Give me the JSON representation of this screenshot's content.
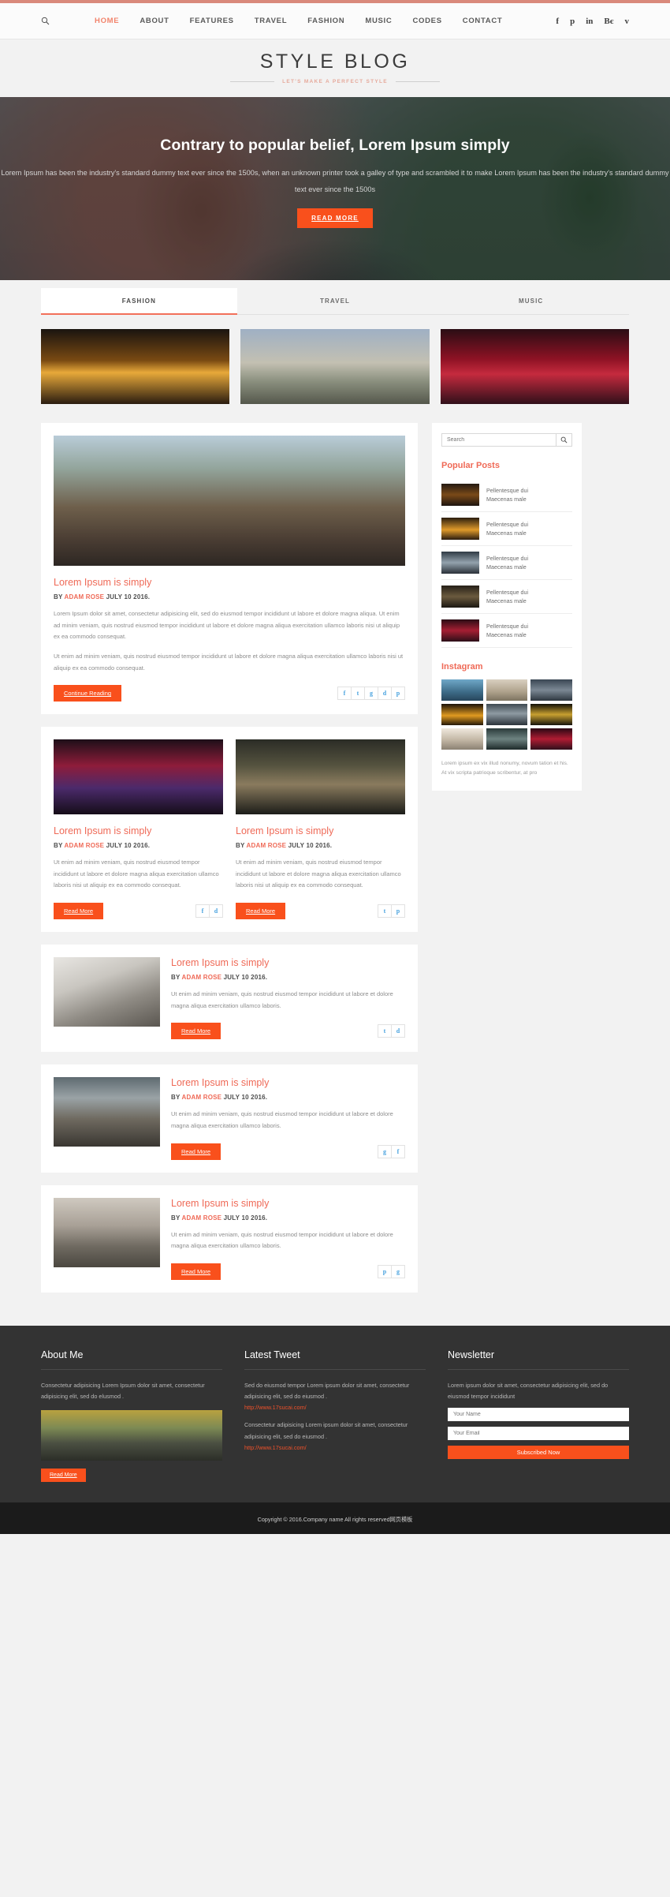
{
  "nav": {
    "search_icon": "search-icon",
    "links": [
      {
        "label": "HOME",
        "active": true
      },
      {
        "label": "ABOUT",
        "active": false
      },
      {
        "label": "FEATURES",
        "active": false
      },
      {
        "label": "TRAVEL",
        "active": false
      },
      {
        "label": "FASHION",
        "active": false
      },
      {
        "label": "MUSIC",
        "active": false
      },
      {
        "label": "CODES",
        "active": false
      },
      {
        "label": "CONTACT",
        "active": false
      }
    ],
    "social": [
      {
        "name": "facebook-icon",
        "glyph": "f"
      },
      {
        "name": "pinterest-icon",
        "glyph": "р"
      },
      {
        "name": "linkedin-icon",
        "glyph": "in"
      },
      {
        "name": "behance-icon",
        "glyph": "Bє"
      },
      {
        "name": "vimeo-icon",
        "glyph": "v"
      }
    ]
  },
  "logo": {
    "title": "STYLE BLOG",
    "tagline": "LET'S MAKE A PERFECT STYLE"
  },
  "hero": {
    "heading": "Contrary to popular belief, Lorem Ipsum simply",
    "paragraph": "Lorem Ipsum has been the industry's standard dummy text ever since the 1500s, when an unknown printer took a galley of type and scrambled it to make Lorem Ipsum has been the industry's standard dummy text ever since the 1500s",
    "button": "READ MORE",
    "accent": "#f9501c"
  },
  "tabs": [
    {
      "label": "FASHION",
      "active": true
    },
    {
      "label": "TRAVEL",
      "active": false
    },
    {
      "label": "MUSIC",
      "active": false
    }
  ],
  "gallery": [
    {
      "name": "gallery-concert-crowd"
    },
    {
      "name": "gallery-street-guitarist"
    },
    {
      "name": "gallery-stage-performance"
    }
  ],
  "posts": {
    "featured": {
      "title": "Lorem Ipsum is simply",
      "meta_by": "BY",
      "meta_author": "ADAM ROSE",
      "meta_date": "JULY 10 2016.",
      "body1": "Lorem Ipsum dolor sit amet, consectetur adipisicing elit, sed do eiusmod tempor incididunt ut labore et dolore magna aliqua. Ut enim ad minim veniam, quis nostrud eiusmod tempor incididunt ut labore et dolore magna aliqua exercitation ullamco laboris nisi ut aliquip ex ea commodo consequat.",
      "body2": "Ut enim ad minim veniam, quis nostrud eiusmod tempor incididunt ut labore et dolore magna aliqua exercitation ullamco laboris nisi ut aliquip ex ea commodo consequat.",
      "button": "Continue Reading",
      "socials": [
        "f",
        "t",
        "g",
        "d",
        "p"
      ]
    },
    "two_col": [
      {
        "title": "Lorem Ipsum is simply",
        "meta_by": "BY",
        "meta_author": "ADAM ROSE",
        "meta_date": "JULY 10 2016.",
        "body": "Ut enim ad minim veniam, quis nostrud eiusmod tempor incididunt ut labore et dolore magna aliqua exercitation ullamco laboris nisi ut aliquip ex ea commodo consequat.",
        "button": "Read More",
        "socials": [
          "f",
          "d"
        ]
      },
      {
        "title": "Lorem Ipsum is simply",
        "meta_by": "BY",
        "meta_author": "ADAM ROSE",
        "meta_date": "JULY 10 2016.",
        "body": "Ut enim ad minim veniam, quis nostrud eiusmod tempor incididunt ut labore et dolore magna aliqua exercitation ullamco laboris nisi ut aliquip ex ea commodo consequat.",
        "button": "Read More",
        "socials": [
          "t",
          "p"
        ]
      }
    ],
    "side_list": [
      {
        "title": "Lorem Ipsum is simply",
        "meta_by": "BY",
        "meta_author": "ADAM ROSE",
        "meta_date": "JULY 10 2016.",
        "body": "Ut enim ad minim veniam, quis nostrud eiusmod tempor incididunt ut labore et dolore magna aliqua exercitation ullamco laboris.",
        "button": "Read More",
        "socials": [
          "t",
          "d"
        ]
      },
      {
        "title": "Lorem Ipsum is simply",
        "meta_by": "BY",
        "meta_author": "ADAM ROSE",
        "meta_date": "JULY 10 2016.",
        "body": "Ut enim ad minim veniam, quis nostrud eiusmod tempor incididunt ut labore et dolore magna aliqua exercitation ullamco laboris.",
        "button": "Read More",
        "socials": [
          "g",
          "f"
        ]
      },
      {
        "title": "Lorem Ipsum is simply",
        "meta_by": "BY",
        "meta_author": "ADAM ROSE",
        "meta_date": "JULY 10 2016.",
        "body": "Ut enim ad minim veniam, quis nostrud eiusmod tempor incididunt ut labore et dolore magna aliqua exercitation ullamco laboris.",
        "button": "Read More",
        "socials": [
          "p",
          "g"
        ]
      }
    ]
  },
  "sidebar": {
    "search_placeholder": "Search",
    "popular_heading": "Popular Posts",
    "popular_posts": [
      {
        "line1": "Pellentesque dui",
        "line2": "Maecenas male"
      },
      {
        "line1": "Pellentesque dui",
        "line2": "Maecenas male"
      },
      {
        "line1": "Pellentesque dui",
        "line2": "Maecenas male"
      },
      {
        "line1": "Pellentesque dui",
        "line2": "Maecenas male"
      },
      {
        "line1": "Pellentesque dui",
        "line2": "Maecenas male"
      }
    ],
    "instagram_heading": "Instagram",
    "instagram_caption": "Lorem ipsum ex vix illud nonumy, novum tation et his. At vix scripta patrioque scribentur, at pro"
  },
  "footer": {
    "about": {
      "heading": "About Me",
      "text": "Consectetur adipisicing Lorem Ipsum dolor sit amet, consectetur adipisicing elit, sed do elusmod .",
      "button": "Read More"
    },
    "tweet": {
      "heading": "Latest Tweet",
      "text1": "Sed do eiusmod tempor Lorem ipsum dolor sit amet, consectetur adipisicing elit, sed do eiusmod .",
      "link1": "http://www.17sucai.com/",
      "text2": "Consectetur adipisicing Lorem ipsum dolor sit amet, consectetur adipisicing elit, sed do eiusmod .",
      "link2": "http://www.17sucai.com/"
    },
    "newsletter": {
      "heading": "Newsletter",
      "text": "Lorem ipsum dolor sit amet, consectetur adipisicing elit, sed do eiusmod tempor incididunt",
      "name_placeholder": "Your Name",
      "email_placeholder": "Your Email",
      "button": "Subscribed Now"
    },
    "copyright": "Copyright © 2016.Company name All rights reserved网页模板"
  }
}
